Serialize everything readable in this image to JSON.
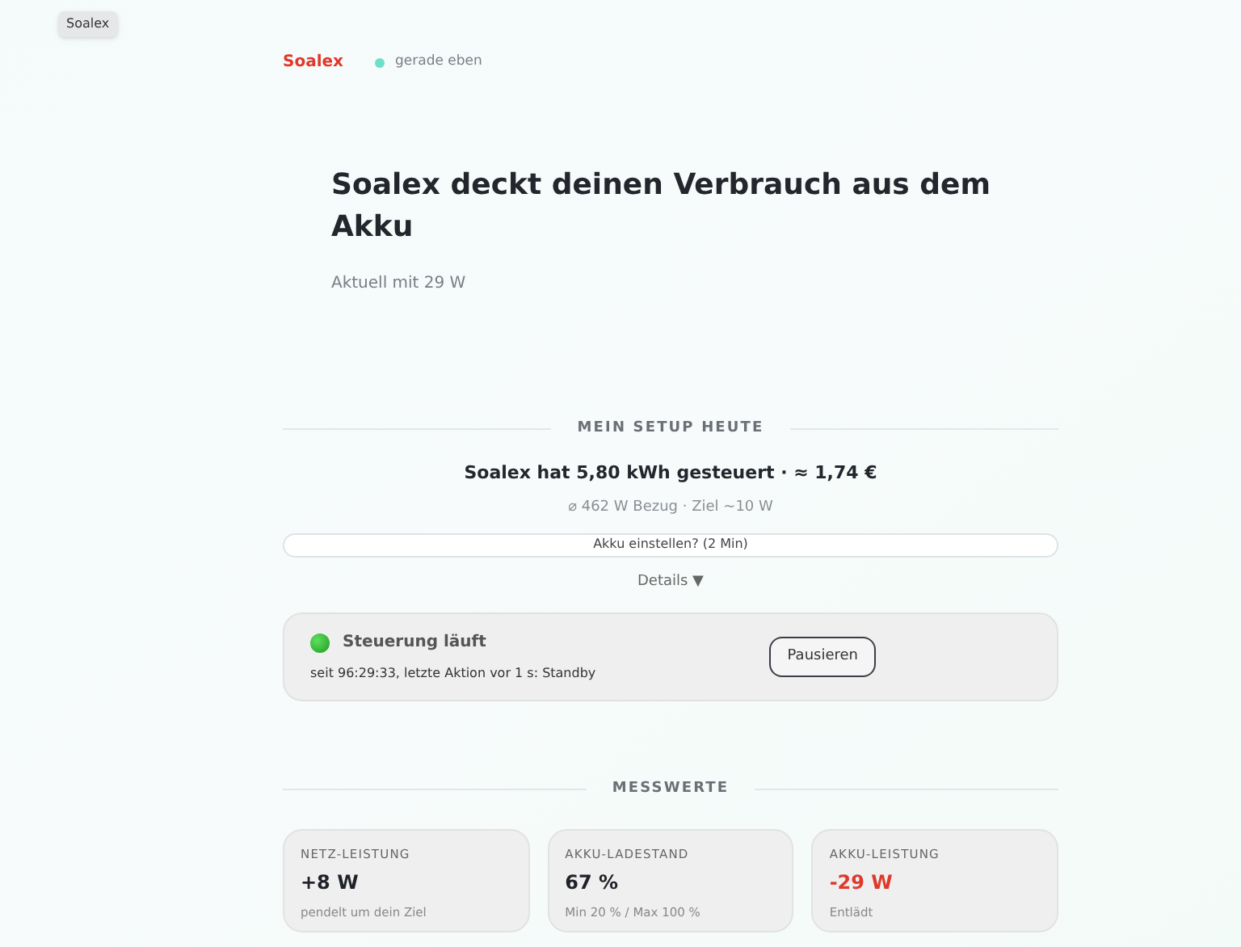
{
  "tooltip": "Soalex",
  "header": {
    "brand": "Soalex",
    "status": "gerade eben",
    "online": true
  },
  "hero": {
    "title": "Soalex deckt deinen Verbrauch aus dem Akku",
    "subtitle": "Aktuell mit 29 W"
  },
  "setup": {
    "heading": "MEIN SETUP HEUTE",
    "summary": "Soalex hat 5,80 kWh gesteuert  ·  ≈ 1,74 €",
    "detail": "⌀ 462 W Bezug · Ziel ~10 W",
    "setup_button": "Akku einstellen? (2 Min)",
    "details_toggle": "Details ▼"
  },
  "control": {
    "title": "Steuerung läuft",
    "running": true,
    "info": "seit 96:29:33, letzte Aktion vor 1 s: Standby",
    "button": "Pausieren"
  },
  "measurements": {
    "heading": "MESSWERTE",
    "cards": [
      {
        "label": "NETZ-LEISTUNG",
        "value": "+8 W",
        "note": "pendelt um dein Ziel",
        "kind": "normal"
      },
      {
        "label": "AKKU-LADESTAND",
        "value": "67 %",
        "note": "Min 20 % / Max 100 %",
        "kind": "normal"
      },
      {
        "label": "AKKU-LEISTUNG",
        "value": "-29 W",
        "note": "Entlädt",
        "kind": "negative"
      }
    ]
  }
}
